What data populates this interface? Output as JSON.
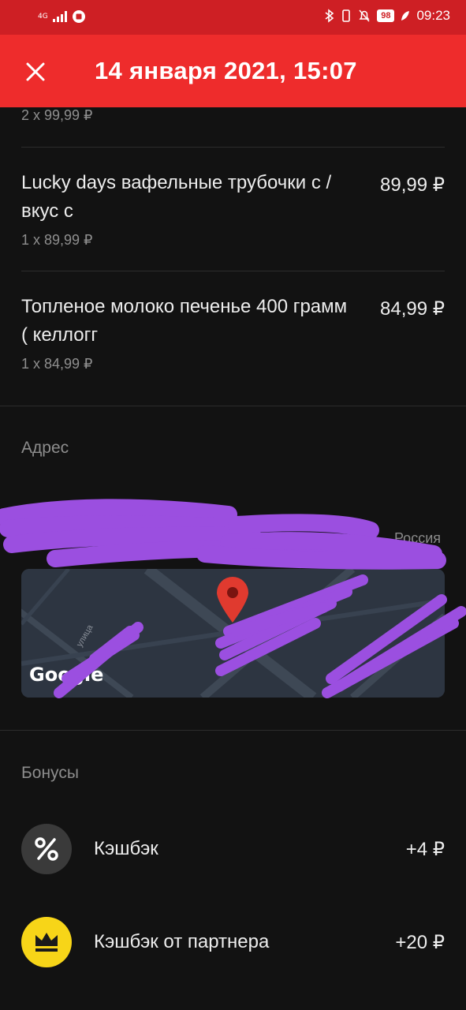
{
  "status_bar": {
    "network": "4G",
    "battery": "98",
    "time": "09:23"
  },
  "toolbar": {
    "title": "14 января 2021, 15:07"
  },
  "items": [
    {
      "name": "",
      "price": "",
      "qty": "2 x 99,99 ₽"
    },
    {
      "name": "Lucky days вафельные трубочки с / вкус с",
      "price": "89,99 ₽",
      "qty": "1 x 89,99 ₽"
    },
    {
      "name": "Топленое молоко печенье 400 грамм ( келлогг",
      "price": "84,99 ₽",
      "qty": "1 x 84,99 ₽"
    }
  ],
  "address": {
    "section_title": "Адрес",
    "country": "Россия",
    "map_logo": "Google",
    "street_fragment": "улица"
  },
  "bonuses": {
    "section_title": "Бонусы",
    "rows": [
      {
        "icon": "percent-icon",
        "label": "Кэшбэк",
        "value": "+4 ₽",
        "icon_bg": "#3a3a3a"
      },
      {
        "icon": "crown-icon",
        "label": "Кэшбэк от партнера",
        "value": "+20 ₽",
        "icon_bg": "#f7d518"
      }
    ]
  },
  "colors": {
    "toolbar": "#ee2c2c",
    "status_bar": "#ce1f24",
    "background": "#121212",
    "map_pin": "#e03a2f",
    "redaction": "#9b4fe0"
  }
}
